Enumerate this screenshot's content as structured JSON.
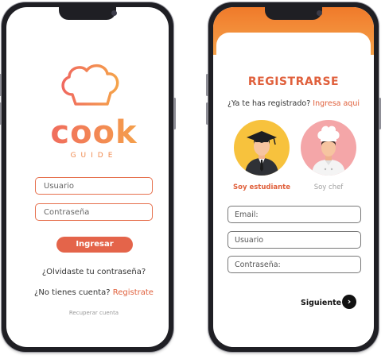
{
  "login": {
    "logo_text": "cook",
    "logo_sub": "GUIDE",
    "username_placeholder": "Usuario",
    "password_placeholder": "Contraseña",
    "login_button": "Ingresar",
    "forgot_password": "¿Olvidaste tu contraseña?",
    "no_account_prefix": "¿No tienes cuenta?",
    "register_link": "Registrate",
    "recover_account": "Recuperar cuenta"
  },
  "register": {
    "title": "REGISTRARSE",
    "already_prefix": "¿Ya te has registrado?",
    "login_link": "Ingresa aqui",
    "roles": [
      {
        "label": "Soy estudiante",
        "color": "#e0603c",
        "icon": "student-avatar-icon"
      },
      {
        "label": "Soy chef",
        "color": "#a0a0a0",
        "icon": "chef-avatar-icon"
      }
    ],
    "email_placeholder": "Email:",
    "username_placeholder": "Usuario",
    "password_placeholder": "Contraseña:",
    "next_button": "Siguiente"
  },
  "colors": {
    "accent": "#e0603c",
    "header_orange": "#f07a2a",
    "student_bg": "#f7c23d",
    "chef_bg": "#f4a6a8"
  }
}
